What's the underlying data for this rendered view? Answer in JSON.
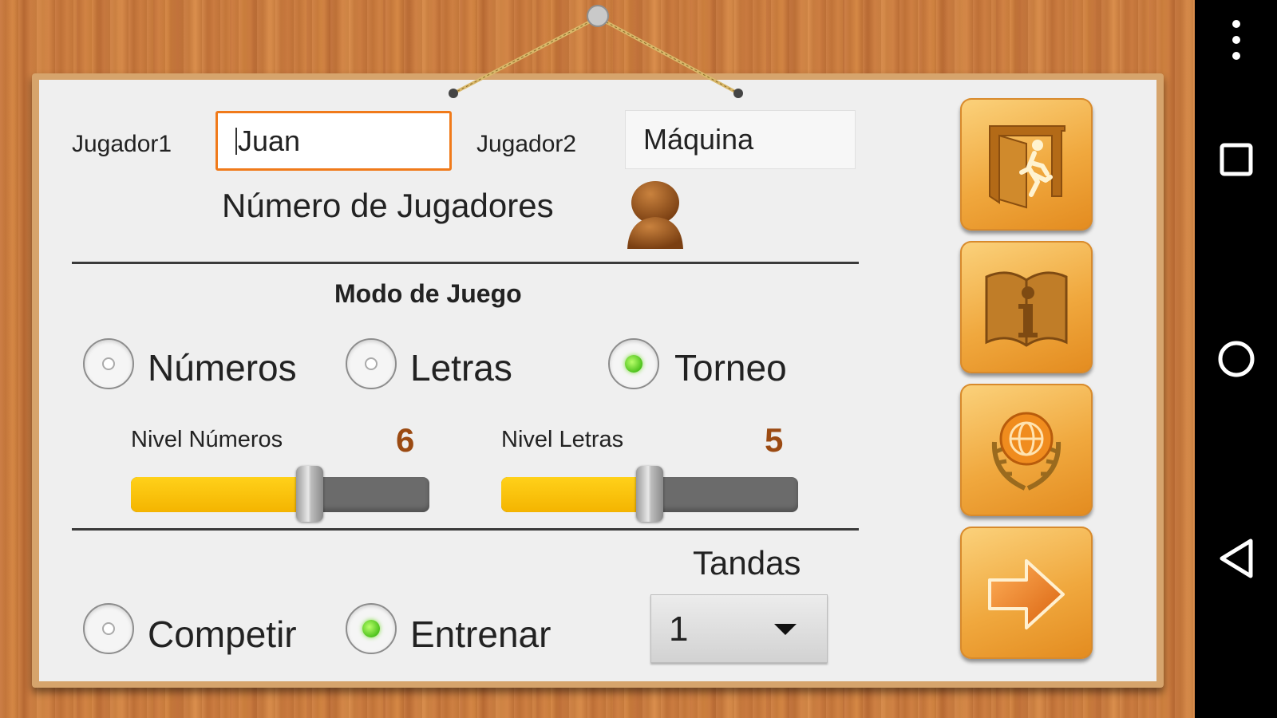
{
  "players": {
    "player1_label": "Jugador1",
    "player1_value": "Juan",
    "player2_label": "Jugador2",
    "player2_value": "Máquina",
    "count_label": "Número de Jugadores",
    "count_icon": "pawn-icon"
  },
  "game_mode": {
    "title": "Modo de Juego",
    "options": [
      "Números",
      "Letras",
      "Torneo"
    ],
    "selected": "Torneo"
  },
  "levels": {
    "numbers_label": "Nivel Números",
    "numbers_value": "6",
    "letters_label": "Nivel Letras",
    "letters_value": "5",
    "numbers_slider_fraction": 0.6,
    "letters_slider_fraction": 0.5
  },
  "mode": {
    "options": [
      "Competir",
      "Entrenar"
    ],
    "selected": "Entrenar"
  },
  "rounds": {
    "label": "Tandas",
    "value": "1"
  },
  "side_buttons": [
    "exit-icon",
    "info-book-icon",
    "globe-laurel-icon",
    "next-arrow-icon"
  ],
  "colors": {
    "accent_orange": "#f07a1a",
    "level_value": "#9b4a12",
    "slider_fill": "#ffd11a",
    "radio_on": "#4ec21d"
  }
}
